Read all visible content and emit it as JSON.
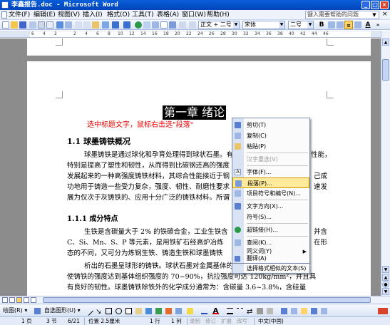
{
  "window": {
    "title": "李鑫报告.doc - Microsoft Word"
  },
  "menu": {
    "items": [
      "文件(F)",
      "编辑(E)",
      "视图(V)",
      "插入(I)",
      "格式(O)",
      "工具(T)",
      "表格(A)",
      "窗口(W)",
      "帮助(H)"
    ],
    "help_placeholder": "键入需要帮助的问题"
  },
  "toolbar": {
    "style_value": "正文 + 二号",
    "font_value": "宋体",
    "size_value": "二号",
    "bold_label": "B"
  },
  "ruler": {
    "numbers": [
      "6",
      "4",
      "2",
      "2",
      "4",
      "6",
      "8",
      "10",
      "12",
      "14",
      "16",
      "18",
      "20",
      "22",
      "24",
      "26",
      "28",
      "30",
      "32",
      "34",
      "36",
      "38",
      "40",
      "42",
      "44",
      "46"
    ]
  },
  "document": {
    "chapter_title": "第一章  绪论",
    "note_text": "选中标题文字，鼠标右击选",
    "note_quoted": "\"段落\"",
    "section_1_1": "1.1  球墨铸铁概况",
    "paragraph_1": [
      "球墨铸铁是通过球化和孕育处理得到球状石墨。有",
      "特别是提高了塑性和韧性，从而得到比碳钢还高的强度",
      "发展起来的一种高强度铸铁材料，其综合性能接近于钢",
      "功地用于铸造一些受力复杂，强度、韧性、耐磨性要求",
      "展为仅次于灰铸铁的、应用十分广泛的铸铁材料。所谓"
    ],
    "paragraph_1_right": [
      "性能，",
      "己成",
      "速发"
    ],
    "section_1_1_1": "1.1.1  成分特点",
    "paragraph_2": [
      "生铁是含碳量大于 2% 的铁碳合金，工业生铁含",
      "C、Si、Mn、S、P 等元素，是用铁矿石经高炉冶炼",
      "态的不同，又可分为炼钢生铁、铸造生铁和球墨铸铁"
    ],
    "paragraph_2_right": [
      "并含",
      "在形"
    ],
    "paragraph_3": [
      "析出的石墨呈球形的铸铁。球状石墨对金属基体的割裂作用比片状石墨小，",
      "使铸铁的强度达到基体组织强度的 70~90%，抗拉强度可达 120kg/mm²，并且具",
      "有良好的韧性。球墨铸铁除铁外的化学成分通常为：含碳量 3.6~3.8%，含硅量"
    ]
  },
  "context_menu": {
    "items": [
      {
        "label": "剪切(T)",
        "icon": "scissors-icon",
        "disabled": false
      },
      {
        "label": "复制(C)",
        "icon": "copy-icon",
        "disabled": false
      },
      {
        "label": "粘贴(P)",
        "icon": "paste-icon",
        "disabled": false
      },
      {
        "label": "汉字重选(V)",
        "icon": "",
        "disabled": true
      },
      {
        "label": "字体(F)...",
        "icon": "font-icon",
        "disabled": false
      },
      {
        "label": "段落(P)...",
        "icon": "paragraph-icon",
        "disabled": false,
        "highlighted": true
      },
      {
        "label": "项目符号和编号(N)...",
        "icon": "bullets-icon",
        "disabled": false
      },
      {
        "label": "文字方向(X)...",
        "icon": "text-direction-icon",
        "disabled": false
      },
      {
        "label": "符号(S)...",
        "icon": "",
        "disabled": false
      },
      {
        "label": "超链接(H)...",
        "icon": "hyperlink-icon",
        "disabled": false
      },
      {
        "label": "查阅(K)...",
        "icon": "research-icon",
        "disabled": false
      },
      {
        "label": "同义词(Y)",
        "icon": "",
        "disabled": false,
        "submenu": true
      },
      {
        "label": "翻译(A)",
        "icon": "translate-icon",
        "disabled": false
      },
      {
        "label": "选择格式相似的文本(S)",
        "icon": "",
        "disabled": false
      }
    ]
  },
  "drawbar": {
    "draw_label": "绘图(R) ▾",
    "autoshape_label": "自选图形(U) ▾"
  },
  "status": {
    "page": "1 页",
    "section": "3 节",
    "page_of": "6/21",
    "position": "位置 2.5厘米",
    "line": "1 行",
    "column": "1 列",
    "rec": "录制",
    "trk": "修订",
    "ext": "扩展",
    "ovr": "改写",
    "language": "中文(中国)"
  },
  "colors": {
    "note_red": "#e00000",
    "highlight_yellow": "#ffe99b",
    "titlebar_blue": "#0a5fd8"
  }
}
